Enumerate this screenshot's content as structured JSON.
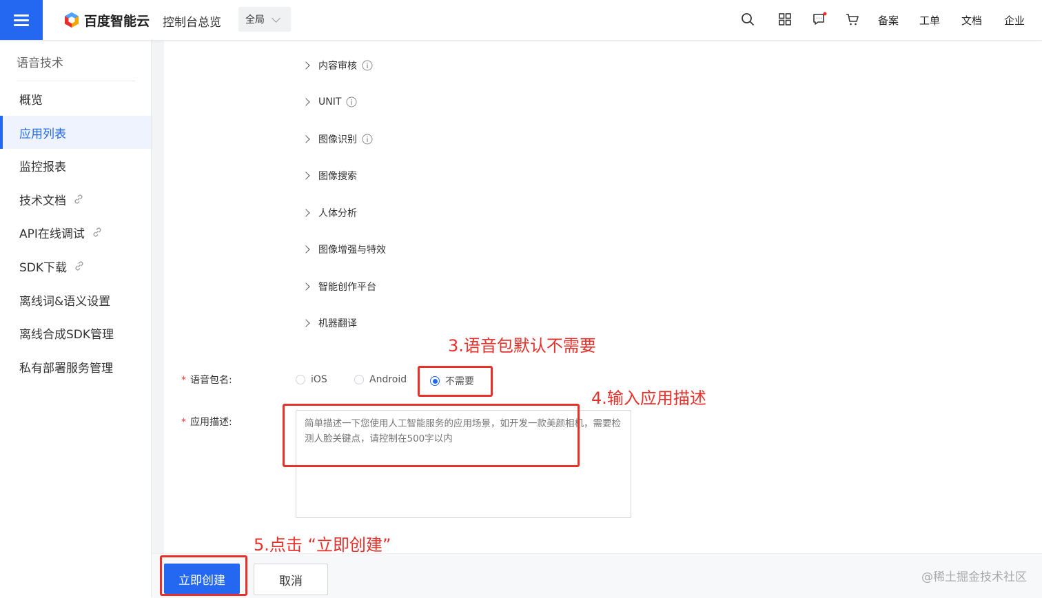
{
  "header": {
    "brand": "百度智能云",
    "console_overview": "控制台总览",
    "scope": "全局",
    "links": [
      "备案",
      "工单",
      "文档",
      "企业"
    ],
    "icons": [
      "search-icon",
      "grid-icon",
      "message-icon",
      "cart-icon"
    ]
  },
  "sidebar": {
    "title": "语音技术",
    "items": [
      {
        "label": "概览",
        "active": false,
        "external": false
      },
      {
        "label": "应用列表",
        "active": true,
        "external": false
      },
      {
        "label": "监控报表",
        "active": false,
        "external": false
      },
      {
        "label": "技术文档",
        "active": false,
        "external": true
      },
      {
        "label": "API在线调试",
        "active": false,
        "external": true
      },
      {
        "label": "SDK下载",
        "active": false,
        "external": true
      },
      {
        "label": "离线词&语义设置",
        "active": false,
        "external": false
      },
      {
        "label": "离线合成SDK管理",
        "active": false,
        "external": false
      },
      {
        "label": "私有部署服务管理",
        "active": false,
        "external": false
      }
    ]
  },
  "tree": {
    "items": [
      {
        "label": "内容审核",
        "info": true
      },
      {
        "label": "UNIT",
        "info": true
      },
      {
        "label": "图像识别",
        "info": true
      },
      {
        "label": "图像搜索",
        "info": false
      },
      {
        "label": "人体分析",
        "info": false
      },
      {
        "label": "图像增强与特效",
        "info": false
      },
      {
        "label": "智能创作平台",
        "info": false
      },
      {
        "label": "机器翻译",
        "info": false
      }
    ]
  },
  "form": {
    "package_label": "语音包名:",
    "package_options": [
      {
        "label": "iOS",
        "checked": false
      },
      {
        "label": "Android",
        "checked": false
      },
      {
        "label": "不需要",
        "checked": true
      }
    ],
    "desc_label": "应用描述:",
    "desc_placeholder": "简单描述一下您使用人工智能服务的应用场景，如开发一款美颜相机，需要检测人脸关键点，请控制在500字以内",
    "required_mark": "*"
  },
  "footer": {
    "create_label": "立即创建",
    "cancel_label": "取消",
    "watermark": "@稀土掘金技术社区"
  },
  "annotations": {
    "step3": "3.语音包默认不需要",
    "step4": "4.输入应用描述",
    "step5": "5.点击 “立即创建”",
    "color": "#e8302b"
  },
  "colors": {
    "primary": "#2468f2",
    "active_bg": "#eef3fe"
  }
}
